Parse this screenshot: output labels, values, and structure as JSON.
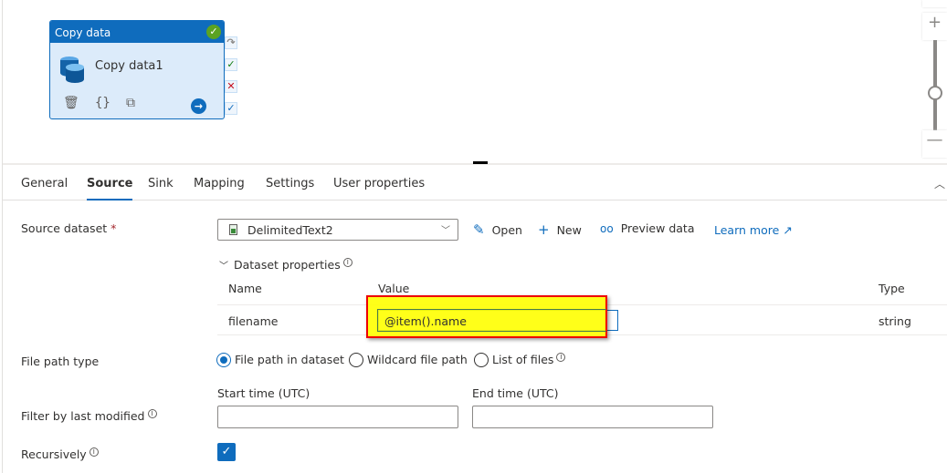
{
  "canvas": {
    "activity": {
      "type_label": "Copy data",
      "name": "Copy data1",
      "status_icon": "check-circle-icon",
      "action_icons": [
        "delete-icon",
        "code-icon",
        "clone-icon",
        "go-arrow-icon"
      ]
    },
    "ports": [
      "skipped-icon",
      "success-icon",
      "failure-icon",
      "completion-icon"
    ],
    "zoom": {
      "in": "+",
      "out": "—",
      "level_fraction": 0.5
    }
  },
  "tabs": [
    {
      "label": "General",
      "active": false
    },
    {
      "label": "Source",
      "active": true
    },
    {
      "label": "Sink",
      "active": false
    },
    {
      "label": "Mapping",
      "active": false
    },
    {
      "label": "Settings",
      "active": false
    },
    {
      "label": "User properties",
      "active": false
    }
  ],
  "source": {
    "dataset_label": "Source dataset",
    "required_mark": "*",
    "dataset_value": "DelimitedText2",
    "actions": {
      "open": "Open",
      "new": "New",
      "preview": "Preview data"
    },
    "learn_more": "Learn more",
    "dataset_properties": {
      "title": "Dataset properties",
      "columns": [
        "Name",
        "Value",
        "Type"
      ],
      "rows": [
        {
          "name": "filename",
          "value": "@item().name",
          "type": "string"
        }
      ]
    },
    "file_path_type": {
      "label": "File path type",
      "options": [
        {
          "label": "File path in dataset",
          "selected": true
        },
        {
          "label": "Wildcard file path",
          "selected": false
        },
        {
          "label": "List of files",
          "selected": false
        }
      ]
    },
    "filter": {
      "label": "Filter by last modified",
      "start_label": "Start time (UTC)",
      "end_label": "End time (UTC)",
      "start_value": "",
      "end_value": ""
    },
    "recursively": {
      "label": "Recursively",
      "checked": true
    }
  }
}
